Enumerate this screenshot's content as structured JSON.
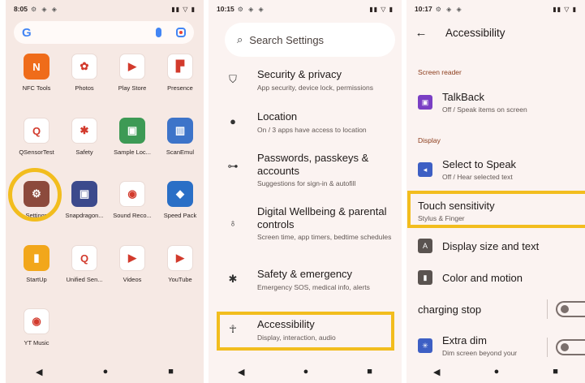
{
  "panel1": {
    "status": {
      "time": "8:05",
      "notif": "⚙ ◈ ◈",
      "sys": "▮▮ ▽ ▮"
    },
    "search": {
      "logo": "G"
    },
    "apps": [
      {
        "label": "NFC Tools",
        "glyph": "N",
        "color": "#ef6c1a"
      },
      {
        "label": "Photos",
        "glyph": "✿",
        "color": "#ffffff"
      },
      {
        "label": "Play Store",
        "glyph": "▶",
        "color": "#ffffff"
      },
      {
        "label": "Presence",
        "glyph": "▛",
        "color": "#ffffff"
      },
      {
        "label": "QSensorTest",
        "glyph": "Q",
        "color": "#ffffff"
      },
      {
        "label": "Safety",
        "glyph": "✱",
        "color": "#ffffff"
      },
      {
        "label": "Sample Loc...",
        "glyph": "▣",
        "color": "#3d9a55"
      },
      {
        "label": "ScanEmul",
        "glyph": "▥",
        "color": "#3d74c9"
      },
      {
        "label": "Settings",
        "glyph": "⚙",
        "color": "#8c4a3c"
      },
      {
        "label": "Snapdragon...",
        "glyph": "▣",
        "color": "#3c4a8c"
      },
      {
        "label": "Sound Reco...",
        "glyph": "◉",
        "color": "#ffffff"
      },
      {
        "label": "Speed Pack",
        "glyph": "◆",
        "color": "#2a6fc6"
      },
      {
        "label": "StartUp",
        "glyph": "▮",
        "color": "#f2a71b"
      },
      {
        "label": "Unified Sen...",
        "glyph": "Q",
        "color": "#ffffff"
      },
      {
        "label": "Videos",
        "glyph": "▶",
        "color": "#ffffff"
      },
      {
        "label": "YouTube",
        "glyph": "▶",
        "color": "#ffffff"
      },
      {
        "label": "YT Music",
        "glyph": "◉",
        "color": "#ffffff"
      }
    ]
  },
  "panel2": {
    "status": {
      "time": "10:15",
      "notif": "⚙ ◈ ◈",
      "sys": "▮▮ ▽ ▮"
    },
    "search_placeholder": "Search Settings",
    "items": [
      {
        "icon": "⛉",
        "title": "Security & privacy",
        "subtitle": "App security, device lock, permissions"
      },
      {
        "icon": "●",
        "title": "Location",
        "subtitle": "On / 3 apps have access to location"
      },
      {
        "icon": "⊶",
        "title": "Passwords, passkeys & accounts",
        "subtitle": "Suggestions for sign-in & autofill"
      },
      {
        "icon": "♁",
        "title": "Digital Wellbeing & parental controls",
        "subtitle": "Screen time, app timers, bedtime schedules"
      },
      {
        "icon": "✱",
        "title": "Safety & emergency",
        "subtitle": "Emergency SOS, medical info, alerts"
      },
      {
        "icon": "☥",
        "title": "Accessibility",
        "subtitle": "Display, interaction, audio"
      }
    ]
  },
  "panel3": {
    "status": {
      "time": "10:17",
      "notif": "⚙ ◈ ◈",
      "sys": "▮▮ ▽ ▮"
    },
    "title": "Accessibility",
    "section_screen_reader": "Screen reader",
    "talkback": {
      "title": "TalkBack",
      "subtitle": "Off / Speak items on screen"
    },
    "section_display": "Display",
    "select_to_speak": {
      "title": "Select to Speak",
      "subtitle": "Off / Hear selected text"
    },
    "touch": {
      "title": "Touch sensitivity",
      "subtitle": "Stylus & Finger"
    },
    "display_size": {
      "title": "Display size and text"
    },
    "color_motion": {
      "title": "Color and motion"
    },
    "charging": {
      "title": "charging stop"
    },
    "extra_dim": {
      "title": "Extra dim",
      "subtitle": "Dim screen beyond your"
    }
  },
  "nav": {
    "back": "◀",
    "home": "●",
    "recents": "■"
  },
  "colors": {
    "highlight": "#f2bd1e",
    "accent": "#8c3d1c"
  }
}
